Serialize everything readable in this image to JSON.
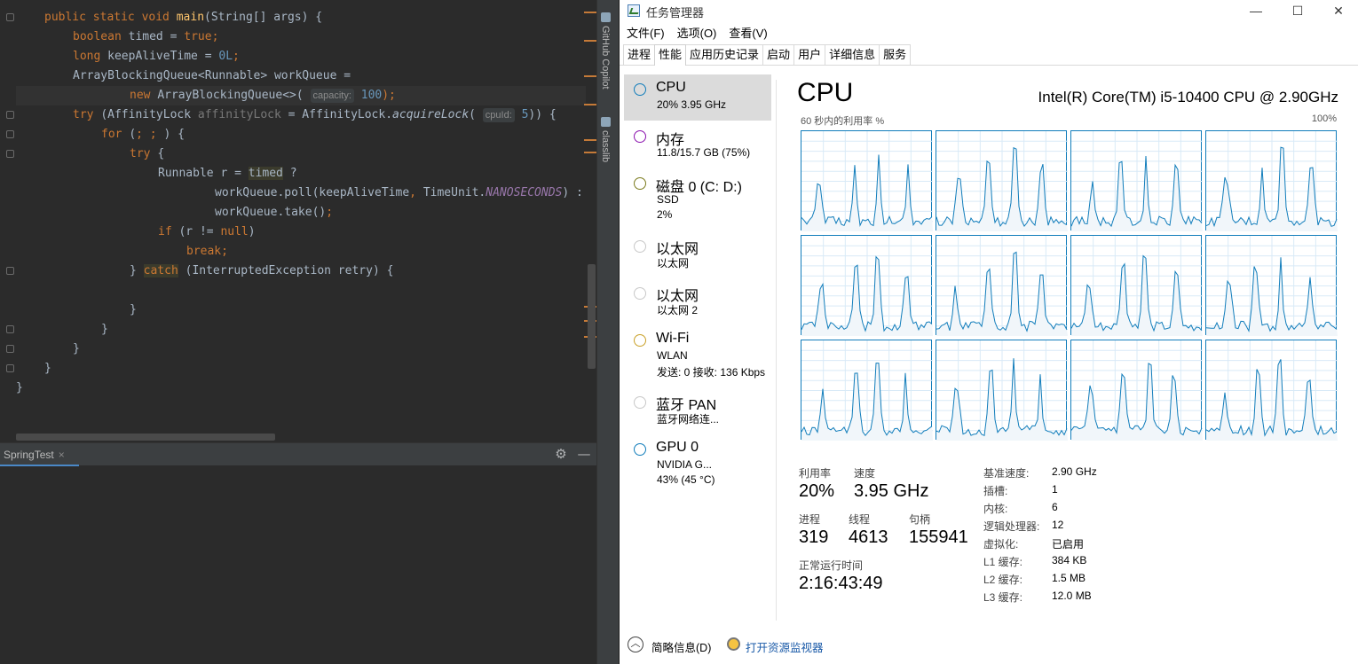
{
  "editor": {
    "lines": {
      "l1": {
        "k1": "public static void ",
        "fn": "main",
        "rest": "(String[] args) {"
      },
      "l2": {
        "k": "boolean ",
        "v": "timed = ",
        "k2": "true",
        ";": ";"
      },
      "l3": {
        "k": "long ",
        "v": "keepAliveTime = ",
        "n": "0L",
        ";": ";"
      },
      "l4": {
        "t": "ArrayBlockingQueue<Runnable> workQueue ="
      },
      "l5": {
        "k": "new ",
        "t": "ArrayBlockingQueue<>( ",
        "hint": "capacity:",
        "n": "100",
        ")": ");"
      },
      "l6": {
        "k": "try ",
        "a": "(AffinityLock ",
        "g": "affinityLock",
        "b": " = AffinityLock.",
        "i": "acquireLock",
        "c": "( ",
        "hint": "cpuId:",
        "n": "5",
        "d": ")) {"
      },
      "l7": {
        "k": "for ",
        "a": "(",
        "k2": "; ; ",
        "b": ") {"
      },
      "l8": {
        "k": "try ",
        "b": "{"
      },
      "l9": {
        "a": "Runnable r = ",
        "h": "timed",
        "b": " ?"
      },
      "l10": {
        "a": "workQueue.poll(keepAliveTime",
        "c": ", ",
        "b": "TimeUnit.",
        "i": "NANOSECONDS",
        "d": ") :"
      },
      "l11": {
        "a": "workQueue.take()",
        "b": ";"
      },
      "l12": {
        "k": "if ",
        "a": "(r != ",
        "k2": "null",
        "b": ")"
      },
      "l13": {
        "k": "break",
        "b": ";"
      },
      "l14": {
        "a": "} ",
        "h": "catch",
        "b": " (InterruptedException retry) {"
      },
      "l15": {
        "a": "}"
      },
      "l16": {
        "a": "}"
      },
      "l17": {
        "a": "}"
      },
      "l18": {
        "a": "}"
      }
    }
  },
  "runpanel": {
    "tab": "SpringTest",
    "close": "×",
    "gear": "⚙",
    "minimize": "—"
  },
  "sidestrip": {
    "copilot": "GitHub Copilot",
    "classlib": "classlib"
  },
  "taskmgr": {
    "title": "任务管理器",
    "window_buttons": {
      "min": "—",
      "max": "☐",
      "close": "✕"
    },
    "menu": [
      "文件(F)",
      "选项(O)",
      "查看(V)"
    ],
    "tabs": [
      "进程",
      "性能",
      "应用历史记录",
      "启动",
      "用户",
      "详细信息",
      "服务"
    ],
    "active_tab": "性能",
    "sidebar": [
      {
        "name": "CPU",
        "sub1": "20%  3.95 GHz",
        "sub2": "",
        "color": "#117dbb"
      },
      {
        "name": "内存",
        "sub1": "11.8/15.7 GB (75%)",
        "sub2": "",
        "color": "#8b12ae"
      },
      {
        "name": "磁盘 0 (C: D:)",
        "sub1": "SSD",
        "sub2": "2%",
        "color": "#4da60c"
      },
      {
        "name": "以太网",
        "sub1": "以太网",
        "sub2": "",
        "color": "#a74f01"
      },
      {
        "name": "以太网",
        "sub1": "以太网 2",
        "sub2": "",
        "color": "#a74f01"
      },
      {
        "name": "Wi-Fi",
        "sub1": "WLAN",
        "sub2": "发送: 0 接收: 136 Kbps",
        "color": "#a74f01"
      },
      {
        "name": "蓝牙 PAN",
        "sub1": "蓝牙网络连...",
        "sub2": "",
        "color": "#a74f01"
      },
      {
        "name": "GPU 0",
        "sub1": "NVIDIA G...",
        "sub2": "43% (45 °C)",
        "color": "#117dbb"
      }
    ],
    "cpu": {
      "heading": "CPU",
      "model": "Intel(R) Core(TM) i5-10400 CPU @ 2.90GHz",
      "graph_caption": "60 秒内的利用率 %",
      "graph_max": "100%",
      "utilization_label": "利用率",
      "utilization": "20%",
      "speed_label": "速度",
      "speed": "3.95 GHz",
      "processes_label": "进程",
      "processes": "319",
      "threads_label": "线程",
      "threads": "4613",
      "handles_label": "句柄",
      "handles": "155941",
      "uptime_label": "正常运行时间",
      "uptime": "2:16:43:49",
      "details": [
        {
          "k": "基准速度:",
          "v": "2.90 GHz"
        },
        {
          "k": "插槽:",
          "v": "1"
        },
        {
          "k": "内核:",
          "v": "6"
        },
        {
          "k": "逻辑处理器:",
          "v": "12"
        },
        {
          "k": "虚拟化:",
          "v": "已启用"
        },
        {
          "k": "L1 缓存:",
          "v": "384 KB"
        },
        {
          "k": "L2 缓存:",
          "v": "1.5 MB"
        },
        {
          "k": "L3 缓存:",
          "v": "12.0 MB"
        }
      ]
    },
    "footer": {
      "brief": "简略信息(D)",
      "brief_icon": "︿",
      "monitor": "打开资源监视器"
    }
  }
}
